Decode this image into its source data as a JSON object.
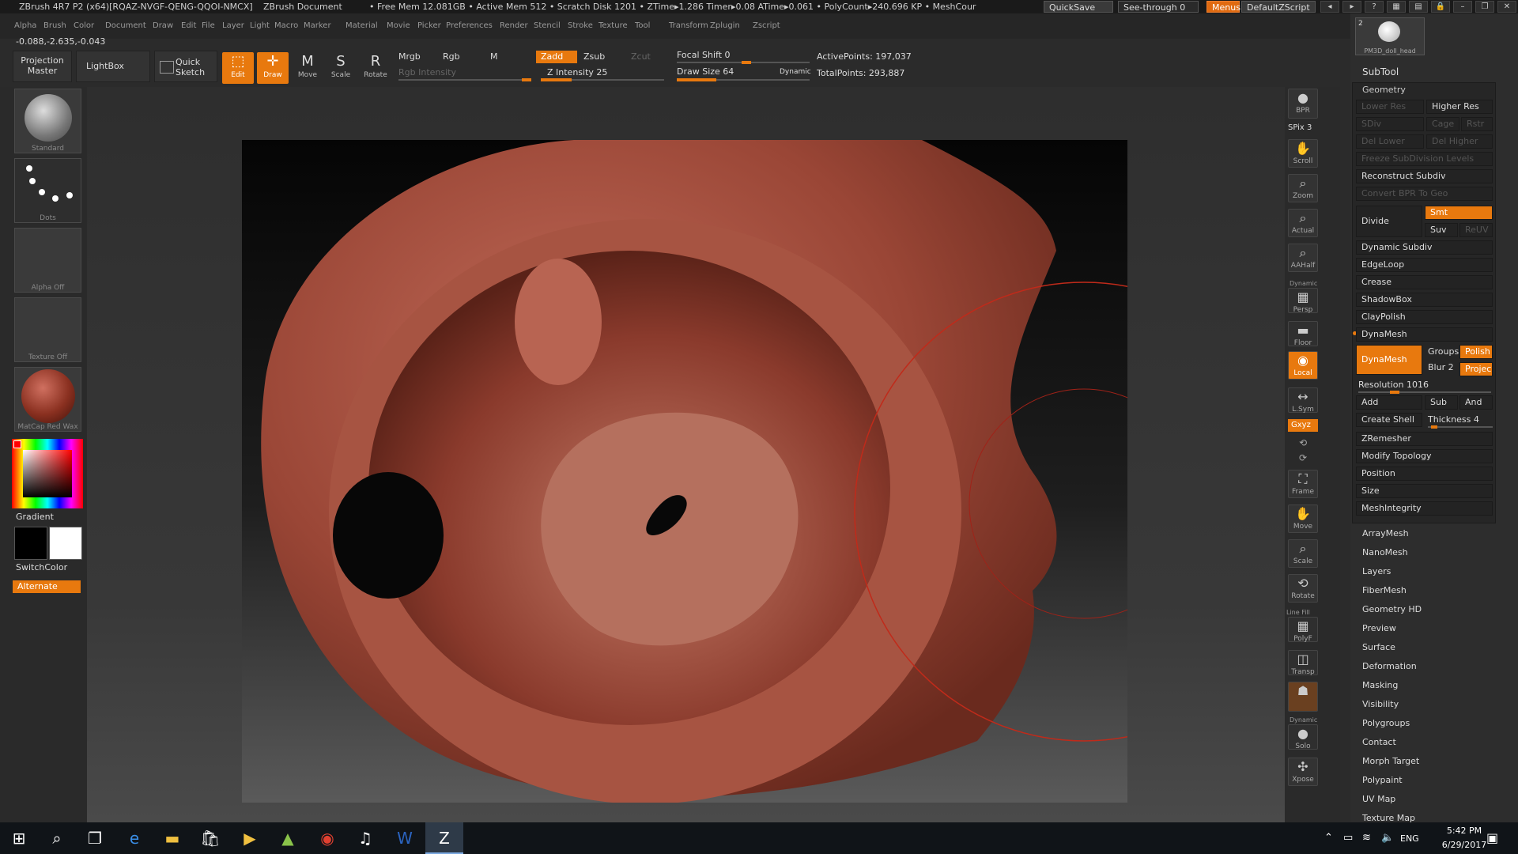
{
  "titlebar": {
    "app": "ZBrush 4R7 P2 (x64)[RQAZ-NVGF-QENG-QQOI-NMCX]",
    "doc": "ZBrush Document",
    "stats": "• Free Mem 12.081GB • Active Mem 512 • Scratch Disk 1201 • ZTime▸1.286 Timer▸0.08 ATime▸0.061 • PolyCount▸240.696 KP • MeshCour",
    "quicksave": "QuickSave",
    "seethrough": "See-through  0",
    "menus": "Menus",
    "script": "DefaultZScript"
  },
  "menubar": [
    "Alpha",
    "Brush",
    "Color",
    "Document",
    "Draw",
    "Edit",
    "File",
    "Layer",
    "Light",
    "Macro",
    "Marker",
    "Material",
    "Movie",
    "Picker",
    "Preferences",
    "Render",
    "Stencil",
    "Stroke",
    "Texture",
    "Tool",
    "Transform",
    "Zplugin",
    "Zscript"
  ],
  "coords": "-0.088,-2.635,-0.043",
  "toolbar": {
    "projection_master": "Projection Master",
    "lightbox": "LightBox",
    "quick_sketch": "Quick Sketch",
    "edit": "Edit",
    "draw": "Draw",
    "move": "Move",
    "scale": "Scale",
    "rotate": "Rotate",
    "mrgb": "Mrgb",
    "rgb": "Rgb",
    "m": "M",
    "rgb_intensity": "Rgb Intensity",
    "zadd": "Zadd",
    "zsub": "Zsub",
    "zcut": "Zcut",
    "z_intensity": "Z Intensity 25",
    "focal_shift": "Focal Shift 0",
    "draw_size": "Draw Size 64",
    "dynamic": "Dynamic",
    "active_points": "ActivePoints: 197,037",
    "total_points": "TotalPoints: 293,887",
    "z_intensity_fraction": 0.25,
    "draw_size_fraction": 0.06
  },
  "leftshelf": {
    "standard": "Standard",
    "dots": "Dots",
    "alpha_off": "Alpha  Off",
    "texture_off": "Texture  Off",
    "matcap": "MatCap Red Wax",
    "gradient": "Gradient",
    "switchcolor": "SwitchColor",
    "alternate": "Alternate"
  },
  "rightshelf": {
    "bpr": "BPR",
    "spix": "SPix 3",
    "scroll": "Scroll",
    "zoom": "Zoom",
    "actual": "Actual",
    "aahalf": "AAHalf",
    "persp": "Persp",
    "dynamic": "Dynamic",
    "floor": "Floor",
    "local": "Local",
    "lsym": "L.Sym",
    "xyz": "Gxyz",
    "frame": "Frame",
    "move": "Move",
    "scale": "Scale",
    "rotate": "Rotate",
    "linefill": "Line Fill",
    "polyf": "PolyF",
    "transp": "Transp",
    "dynamic2": "Dynamic",
    "solo": "Solo",
    "xpose": "Xpose"
  },
  "panel": {
    "thumb_label": "PM3D_doll_head",
    "thumb_count": "2",
    "subtool": "SubTool",
    "geometry": "Geometry",
    "lower_res": "Lower Res",
    "higher_res": "Higher Res",
    "sdiv": "SDiv",
    "cage": "Cage",
    "rstr": "Rstr",
    "del_lower": "Del Lower",
    "del_higher": "Del Higher",
    "freeze": "Freeze SubDivision Levels",
    "reconstruct": "Reconstruct Subdiv",
    "convert_bpr": "Convert BPR To Geo",
    "divide": "Divide",
    "smt": "Smt",
    "suv": "Suv",
    "reuv": "ReUV",
    "dynamic_subdiv": "Dynamic Subdiv",
    "edgeloop": "EdgeLoop",
    "crease": "Crease",
    "shadowbox": "ShadowBox",
    "claypolish": "ClayPolish",
    "dynamesh_header": "DynaMesh",
    "dynamesh_btn": "DynaMesh",
    "groups": "Groups",
    "polish": "Polish",
    "blur": "Blur 2",
    "project": "Projec",
    "resolution": "Resolution 1016",
    "add": "Add",
    "sub": "Sub",
    "and": "And",
    "create_shell": "Create Shell",
    "thickness": "Thickness 4",
    "zremesher": "ZRemesher",
    "modify_topology": "Modify Topology",
    "position": "Position",
    "size": "Size",
    "meshintegrity": "MeshIntegrity",
    "sections": [
      "ArrayMesh",
      "NanoMesh",
      "Layers",
      "FiberMesh",
      "Geometry HD",
      "Preview",
      "Surface",
      "Deformation",
      "Masking",
      "Visibility",
      "Polygroups",
      "Contact",
      "Morph Target",
      "Polypaint",
      "UV Map",
      "Texture Map"
    ]
  },
  "taskbar": {
    "lang": "ENG",
    "time": "5:42 PM",
    "date": "6/29/2017"
  },
  "colors": {
    "accent": "#e8790e",
    "model": "#a8503e",
    "brush_ring": "#c02a1a"
  }
}
